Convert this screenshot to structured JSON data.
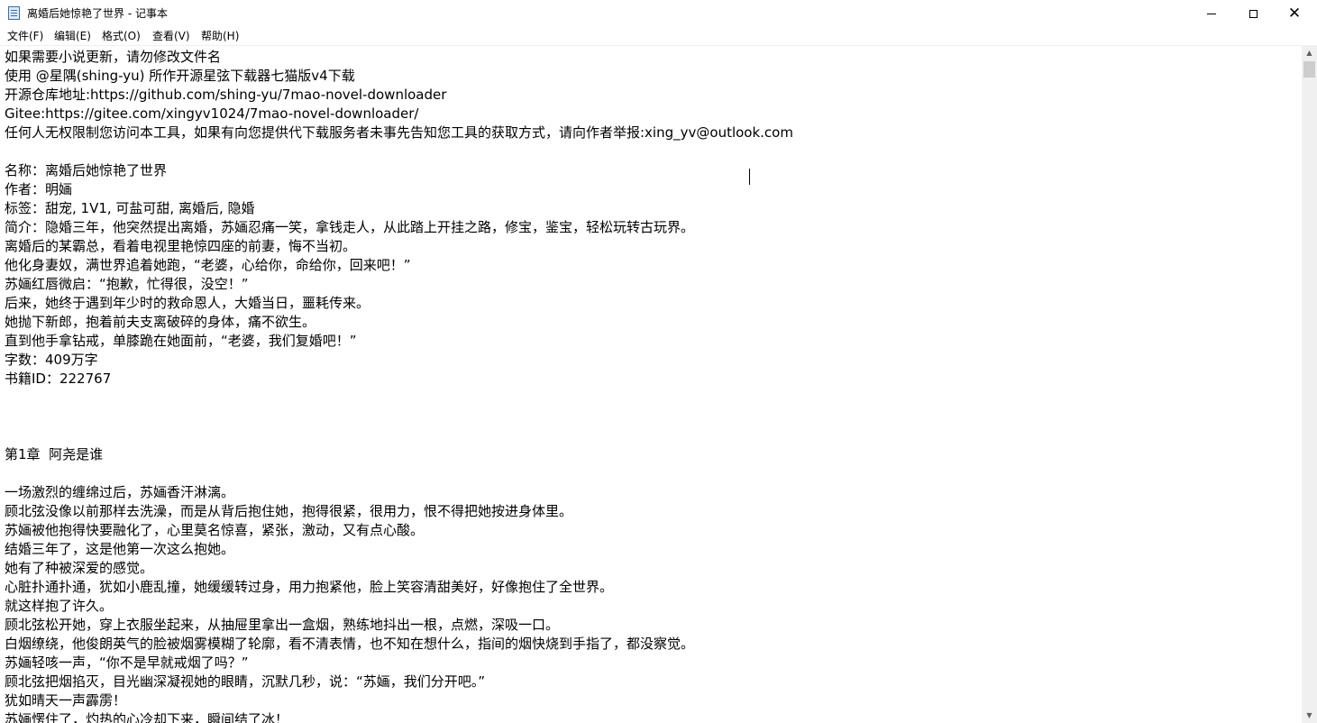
{
  "window": {
    "title": "离婚后她惊艳了世界 - 记事本",
    "app_icon": "notepad-icon",
    "controls": {
      "minimize": "minimize-icon",
      "maximize": "maximize-icon",
      "close_glyph": "✕"
    }
  },
  "menu": {
    "items": [
      {
        "label": "文件(F)"
      },
      {
        "label": "编辑(E)"
      },
      {
        "label": "格式(O)"
      },
      {
        "label": "查看(V)"
      },
      {
        "label": "帮助(H)"
      }
    ]
  },
  "document": {
    "lines": [
      "如果需要小说更新，请勿修改文件名",
      "使用 @星隅(shing-yu) 所作开源星弦下载器七猫版v4下载",
      "开源仓库地址:https://github.com/shing-yu/7mao-novel-downloader",
      "Gitee:https://gitee.com/xingyv1024/7mao-novel-downloader/",
      "任何人无权限制您访问本工具，如果有向您提供代下载服务者未事先告知您工具的获取方式，请向作者举报:xing_yv@outlook.com",
      "",
      "名称：离婚后她惊艳了世界",
      "作者：明婳",
      "标签：甜宠, 1V1, 可盐可甜, 离婚后, 隐婚",
      "简介：隐婚三年，他突然提出离婚，苏婳忍痛一笑，拿钱走人，从此踏上开挂之路，修宝，鉴宝，轻松玩转古玩界。",
      "离婚后的某霸总，看着电视里艳惊四座的前妻，悔不当初。",
      "他化身妻奴，满世界追着她跑，“老婆，心给你，命给你，回来吧！”",
      "苏婳红唇微启：“抱歉，忙得很，没空！”",
      "后来，她终于遇到年少时的救命恩人，大婚当日，噩耗传来。",
      "她抛下新郎，抱着前夫支离破碎的身体，痛不欲生。",
      "直到他手拿钻戒，单膝跪在她面前，“老婆，我们复婚吧！”",
      "字数：409万字",
      "书籍ID：222767",
      "",
      "",
      "",
      "第1章  阿尧是谁",
      "",
      "一场激烈的缠绵过后，苏婳香汗淋漓。",
      "顾北弦没像以前那样去洗澡，而是从背后抱住她，抱得很紧，很用力，恨不得把她按进身体里。",
      "苏婳被他抱得快要融化了，心里莫名惊喜，紧张，激动，又有点心酸。",
      "结婚三年了，这是他第一次这么抱她。",
      "她有了种被深爱的感觉。",
      "心脏扑通扑通，犹如小鹿乱撞，她缓缓转过身，用力抱紧他，脸上笑容清甜美好，好像抱住了全世界。",
      "就这样抱了许久。",
      "顾北弦松开她，穿上衣服坐起来，从抽屉里拿出一盒烟，熟练地抖出一根，点燃，深吸一口。",
      "白烟缭绕，他俊朗英气的脸被烟雾模糊了轮廓，看不清表情，也不知在想什么，指间的烟快烧到手指了，都没察觉。",
      "苏婳轻咳一声，“你不是早就戒烟了吗？”",
      "顾北弦把烟掐灭，目光幽深凝视她的眼睛，沉默几秒，说：“苏婳，我们分开吧。”",
      "犹如晴天一声霹雳！",
      "苏婳愣住了，灼热的心冷却下来，瞬间结了冰！"
    ]
  },
  "scrollbar": {
    "up_arrow": "▲",
    "down_arrow": "▼"
  }
}
